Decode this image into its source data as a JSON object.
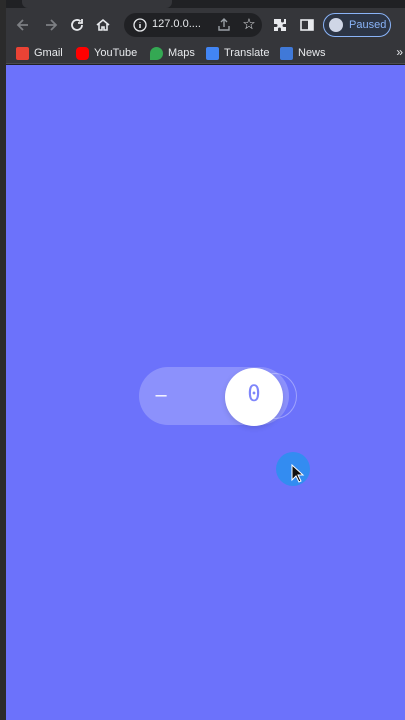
{
  "browser": {
    "url_display": "127.0.0....",
    "profile_status": "Paused",
    "bookmarks": [
      {
        "label": "Gmail",
        "icon": "gmail-icon",
        "color": "#ea4335"
      },
      {
        "label": "YouTube",
        "icon": "youtube-icon",
        "color": "#ff0000"
      },
      {
        "label": "Maps",
        "icon": "maps-icon",
        "color": "#34a853"
      },
      {
        "label": "Translate",
        "icon": "translate-icon",
        "color": "#4285f4"
      },
      {
        "label": "News",
        "icon": "news-icon",
        "color": "#4285f4"
      }
    ],
    "more_bookmarks": "»"
  },
  "counter": {
    "decrement_label": "–",
    "value": "0"
  },
  "colors": {
    "page_background": "#6c72fb",
    "knob": "#ffffff",
    "cursor_highlight": "#2d8ff0"
  }
}
